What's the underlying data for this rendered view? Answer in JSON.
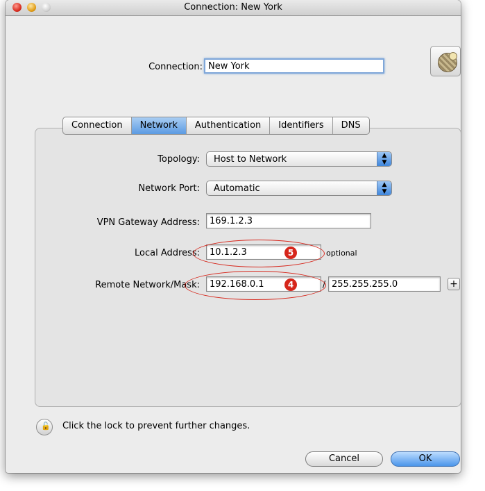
{
  "window": {
    "title": "Connection: New York"
  },
  "connection": {
    "label": "Connection:",
    "value": "New York"
  },
  "tabs": [
    "Connection",
    "Network",
    "Authentication",
    "Identifiers",
    "DNS"
  ],
  "active_tab": "Network",
  "form": {
    "topology_label": "Topology:",
    "topology_value": "Host to Network",
    "network_port_label": "Network Port:",
    "network_port_value": "Automatic",
    "vpn_gateway_label": "VPN Gateway Address:",
    "vpn_gateway_value": "169.1.2.3",
    "local_address_label": "Local Address:",
    "local_address_value": "10.1.2.3",
    "optional_text": "optional",
    "remote_label": "Remote Network/Mask:",
    "remote_network_value": "192.168.0.1",
    "slash": "/",
    "remote_mask_value": "255.255.255.0",
    "add_button_label": "+"
  },
  "callouts": {
    "local": "5",
    "remote": "4"
  },
  "lock_text": "Click the lock to prevent further changes.",
  "buttons": {
    "cancel": "Cancel",
    "ok": "OK"
  },
  "colors": {
    "callout": "#d6261b",
    "tab_active": "#5b9be3",
    "default_button": "#4b95ea"
  },
  "icons": {
    "connection": "globe-icon",
    "lock": "lock-icon"
  }
}
